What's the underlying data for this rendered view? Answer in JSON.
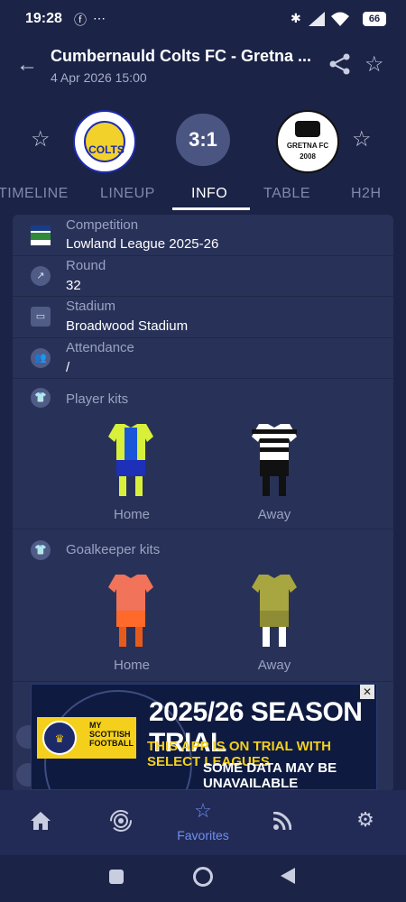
{
  "status": {
    "time": "19:28",
    "battery": "66"
  },
  "header": {
    "title": "Cumbernauld Colts FC - Gretna ...",
    "datetime": "4 Apr 2026 15:00"
  },
  "match": {
    "home_crest_text": "COLTS",
    "away_crest_text": "GRETNA FC",
    "away_crest_year": "2008",
    "score": "3:1"
  },
  "tabs": [
    "TIMELINE",
    "LINEUP",
    "INFO",
    "TABLE",
    "H2H"
  ],
  "active_tab": "INFO",
  "info": {
    "competition_label": "Competition",
    "competition_value": "Lowland League 2025-26",
    "round_label": "Round",
    "round_value": "32",
    "stadium_label": "Stadium",
    "stadium_value": "Broadwood Stadium",
    "attendance_label": "Attendance",
    "attendance_value": "/"
  },
  "kits": {
    "player_title": "Player kits",
    "goalkeeper_title": "Goalkeeper kits",
    "home_label": "Home",
    "away_label": "Away",
    "colors": {
      "player_home_shirt": "#1a56d8",
      "player_home_accent": "#d8f03a",
      "player_home_shorts": "#1e2fb8",
      "player_away_shirt": "#ffffff",
      "player_away_stripe": "#111111",
      "player_away_shorts": "#111111",
      "gk_home_shirt": "#f0735a",
      "gk_home_shorts": "#ff6a2a",
      "gk_away_shirt": "#a8a640",
      "gk_away_shorts": "#8e8c34"
    }
  },
  "ad": {
    "headline": "2025/26 SEASON TRIAL",
    "line1": "THIS APP IS ON TRIAL WITH SELECT LEAGUES",
    "line2": "SOME DATA MAY BE UNAVAILABLE",
    "brand": "MY SCOTTISH FOOTBALL",
    "close": "✕"
  },
  "bottom_nav": {
    "favorites_label": "Favorites"
  }
}
